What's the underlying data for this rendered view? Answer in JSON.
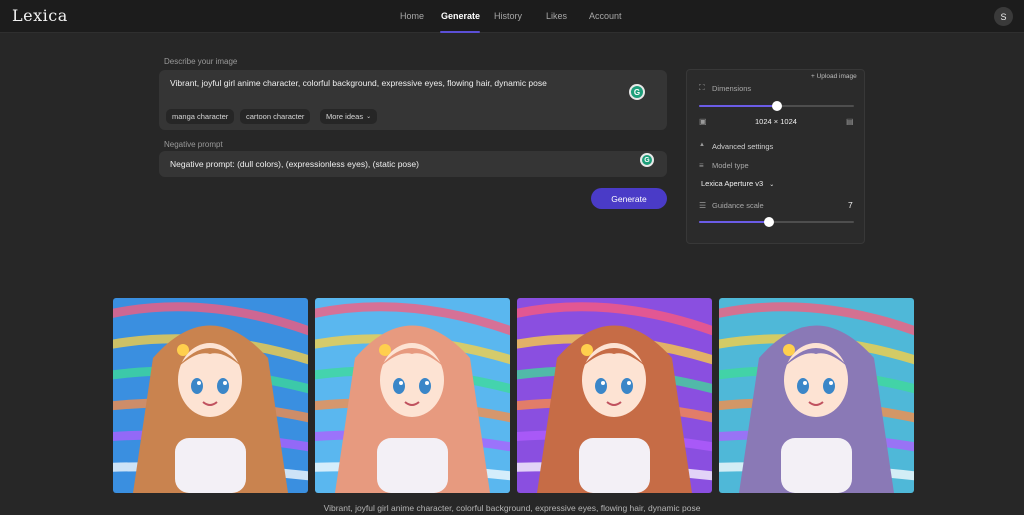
{
  "app": {
    "logo": "Lexica"
  },
  "nav": {
    "items": [
      {
        "label": "Home"
      },
      {
        "label": "Generate"
      },
      {
        "label": "History"
      },
      {
        "label": "Likes"
      },
      {
        "label": "Account"
      }
    ],
    "active": "Generate",
    "avatar_initial": "S"
  },
  "prompt": {
    "label": "Describe your image",
    "value": "Vibrant, joyful girl anime character, colorful background, expressive eyes, flowing hair, dynamic pose",
    "chips": [
      "manga character",
      "cartoon character",
      "More ideas"
    ]
  },
  "negative": {
    "label": "Negative prompt",
    "value": "Negative prompt: (dull colors), (expressionless eyes), (static pose)"
  },
  "generate_label": "Generate",
  "settings": {
    "upload_label": "+ Upload image",
    "dimensions_label": "Dimensions",
    "dimensions_slider_fraction": 0.5,
    "dimensions_value": "1024 × 1024",
    "advanced_label": "Advanced settings",
    "model_type_label": "Model type",
    "model_value": "Lexica Aperture v3",
    "guidance_label": "Guidance scale",
    "guidance_value": "7",
    "guidance_slider_fraction": 0.45
  },
  "results": {
    "images": [
      {
        "name": "result-image-1",
        "hair": "#c9834f",
        "bg": "#3a8fe0"
      },
      {
        "name": "result-image-2",
        "hair": "#e79a7f",
        "bg": "#5ab7ef"
      },
      {
        "name": "result-image-3",
        "hair": "#c66c46",
        "bg": "#8a4fe0"
      },
      {
        "name": "result-image-4",
        "hair": "#8a79b6",
        "bg": "#4fb8d8"
      }
    ],
    "caption": "Vibrant, joyful girl anime character, colorful background, expressive eyes, flowing hair, dynamic pose"
  },
  "colors": {
    "accent": "#4a3bc7",
    "slider_fill": "#6b5ce7",
    "background": "#272727",
    "input_bg": "#353535"
  }
}
